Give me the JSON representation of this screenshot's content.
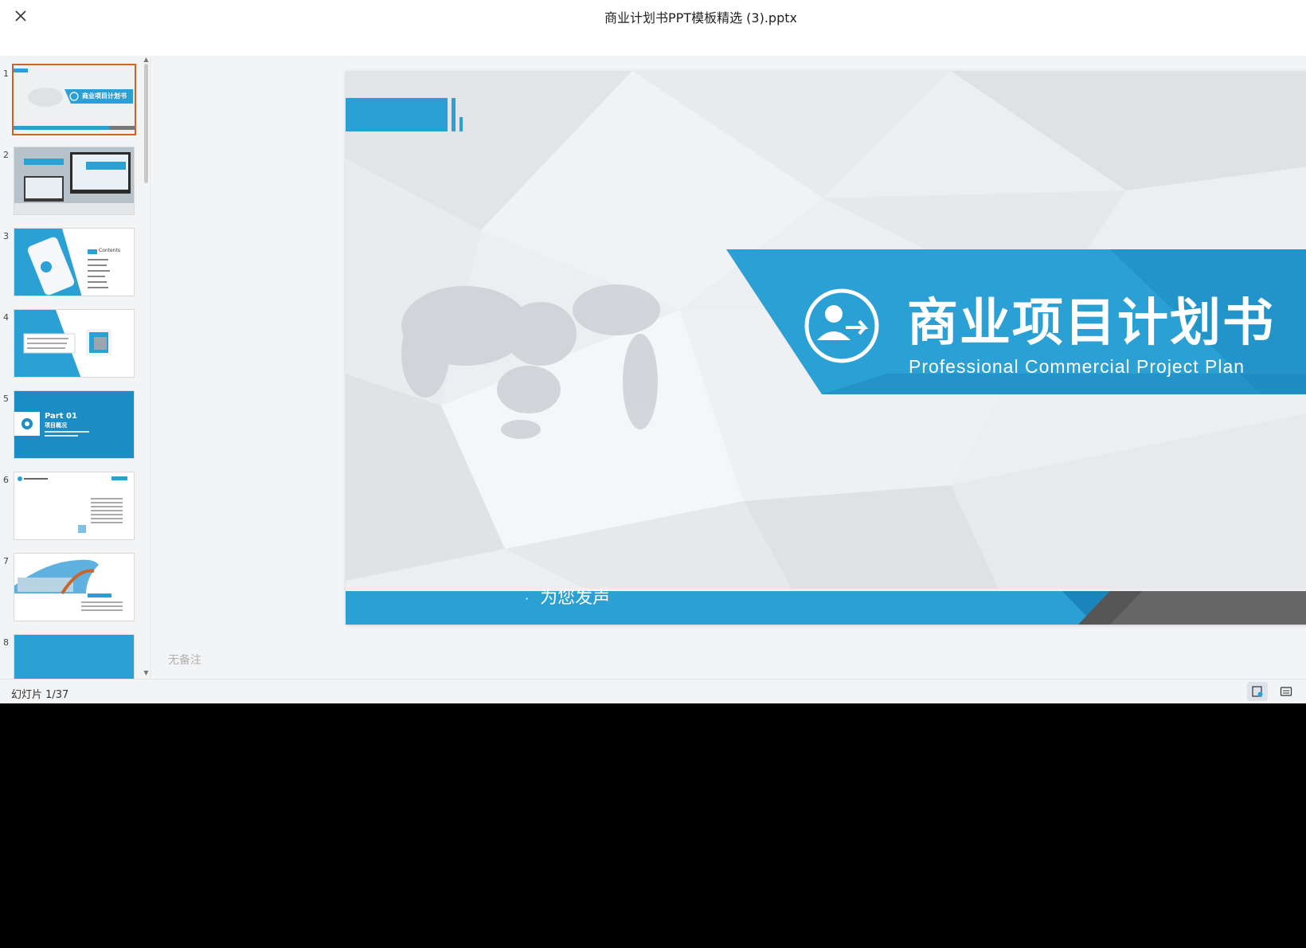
{
  "window": {
    "title": "商业计划书PPT模板精选 (3).pptx"
  },
  "thumbnails": [
    {
      "number": "1",
      "active": true,
      "caption": "商业项目计划书"
    },
    {
      "number": "2",
      "active": false
    },
    {
      "number": "3",
      "active": false,
      "caption": "Contents"
    },
    {
      "number": "4",
      "active": false
    },
    {
      "number": "5",
      "active": false,
      "caption": "Part 01",
      "caption2": "项目概况"
    },
    {
      "number": "6",
      "active": false
    },
    {
      "number": "7",
      "active": false
    },
    {
      "number": "8",
      "active": false
    }
  ],
  "slide": {
    "title": "商业项目计划书",
    "subtitle": "Professional Commercial Project Plan",
    "bottom_text": "为您发声",
    "bottom_dot": "·",
    "colors": {
      "accent": "#2aa0d4",
      "accent_dark": "#1b85bb",
      "gray_band": "#666666"
    }
  },
  "notes": {
    "placeholder": "无备注"
  },
  "status": {
    "slide_counter": "幻灯片 1/37"
  },
  "icons": {
    "close": "close-icon",
    "notes_toggle": "notes-icon",
    "comments_toggle": "comments-icon"
  }
}
